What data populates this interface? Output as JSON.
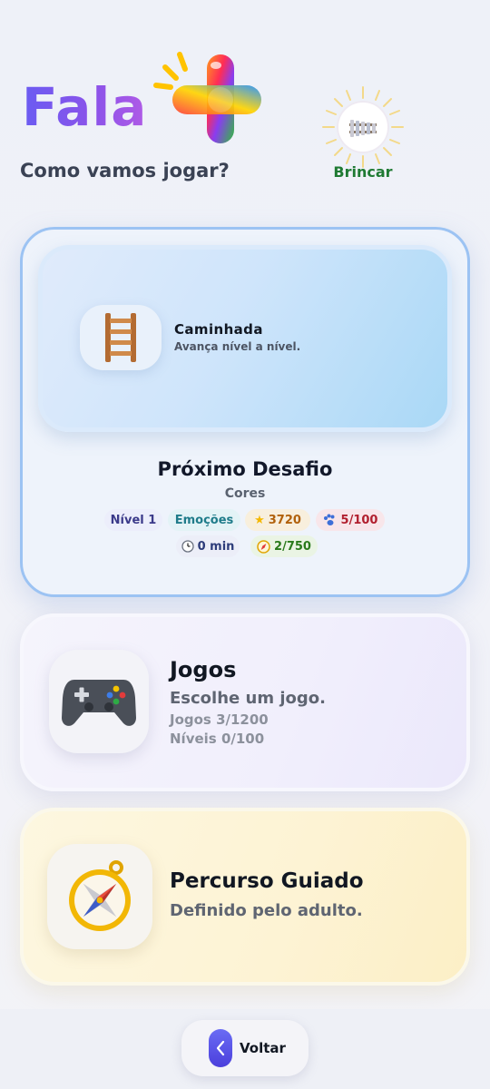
{
  "header": {
    "logo_text": "Fala",
    "subtitle": "Como vamos jogar?",
    "play_button_label": "Brincar"
  },
  "current_mode": {
    "icon": "ladder-icon",
    "title": "Caminhada",
    "subtitle": "Avança nível a nível."
  },
  "next_challenge": {
    "title": "Próximo Desafio",
    "subtitle": "Cores",
    "level": "Nível 1",
    "category": "Emoções",
    "stars": "3720",
    "paws": "5/100",
    "time": "0 min",
    "compass": "2/750"
  },
  "games": {
    "icon": "gamepad-icon",
    "title": "Jogos",
    "subtitle": "Escolhe um jogo.",
    "games_count": "Jogos 3/1200",
    "levels_count": "Níveis 0/100"
  },
  "guided": {
    "icon": "compass-icon",
    "title": "Percurso Guiado",
    "subtitle": "Definido pelo adulto."
  },
  "footer": {
    "back_label": "Voltar"
  },
  "colors": {
    "accent": "#6a5cf2",
    "play_green": "#1f7a33",
    "main_card_border": "#9cc3f3"
  }
}
